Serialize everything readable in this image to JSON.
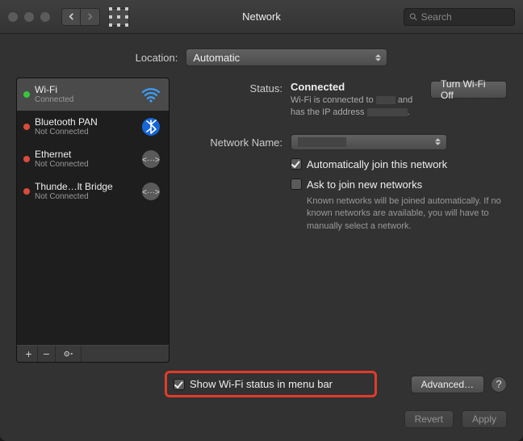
{
  "window": {
    "title": "Network"
  },
  "search": {
    "placeholder": "Search"
  },
  "location": {
    "label": "Location:",
    "value": "Automatic"
  },
  "sidebar": {
    "items": [
      {
        "name": "Wi-Fi",
        "status": "Connected",
        "dot": "green",
        "icon": "wifi",
        "selected": true
      },
      {
        "name": "Bluetooth PAN",
        "status": "Not Connected",
        "dot": "red",
        "icon": "bluetooth"
      },
      {
        "name": "Ethernet",
        "status": "Not Connected",
        "dot": "red",
        "icon": "ethernet"
      },
      {
        "name": "Thunde…lt Bridge",
        "status": "Not Connected",
        "dot": "red",
        "icon": "ethernet"
      }
    ]
  },
  "detail": {
    "status_label": "Status:",
    "status_value": "Connected",
    "turn_off": "Turn Wi-Fi Off",
    "status_desc_a": "Wi-Fi is connected to",
    "status_desc_b": "and has the IP address",
    "network_name_label": "Network Name:",
    "network_name_value": "",
    "auto_join": "Automatically join this network",
    "ask_join": "Ask to join new networks",
    "ask_desc": "Known networks will be joined automatically. If no known networks are available, you will have to manually select a network."
  },
  "bottom": {
    "show_status": "Show Wi-Fi status in menu bar",
    "advanced": "Advanced…"
  },
  "footer": {
    "revert": "Revert",
    "apply": "Apply"
  }
}
